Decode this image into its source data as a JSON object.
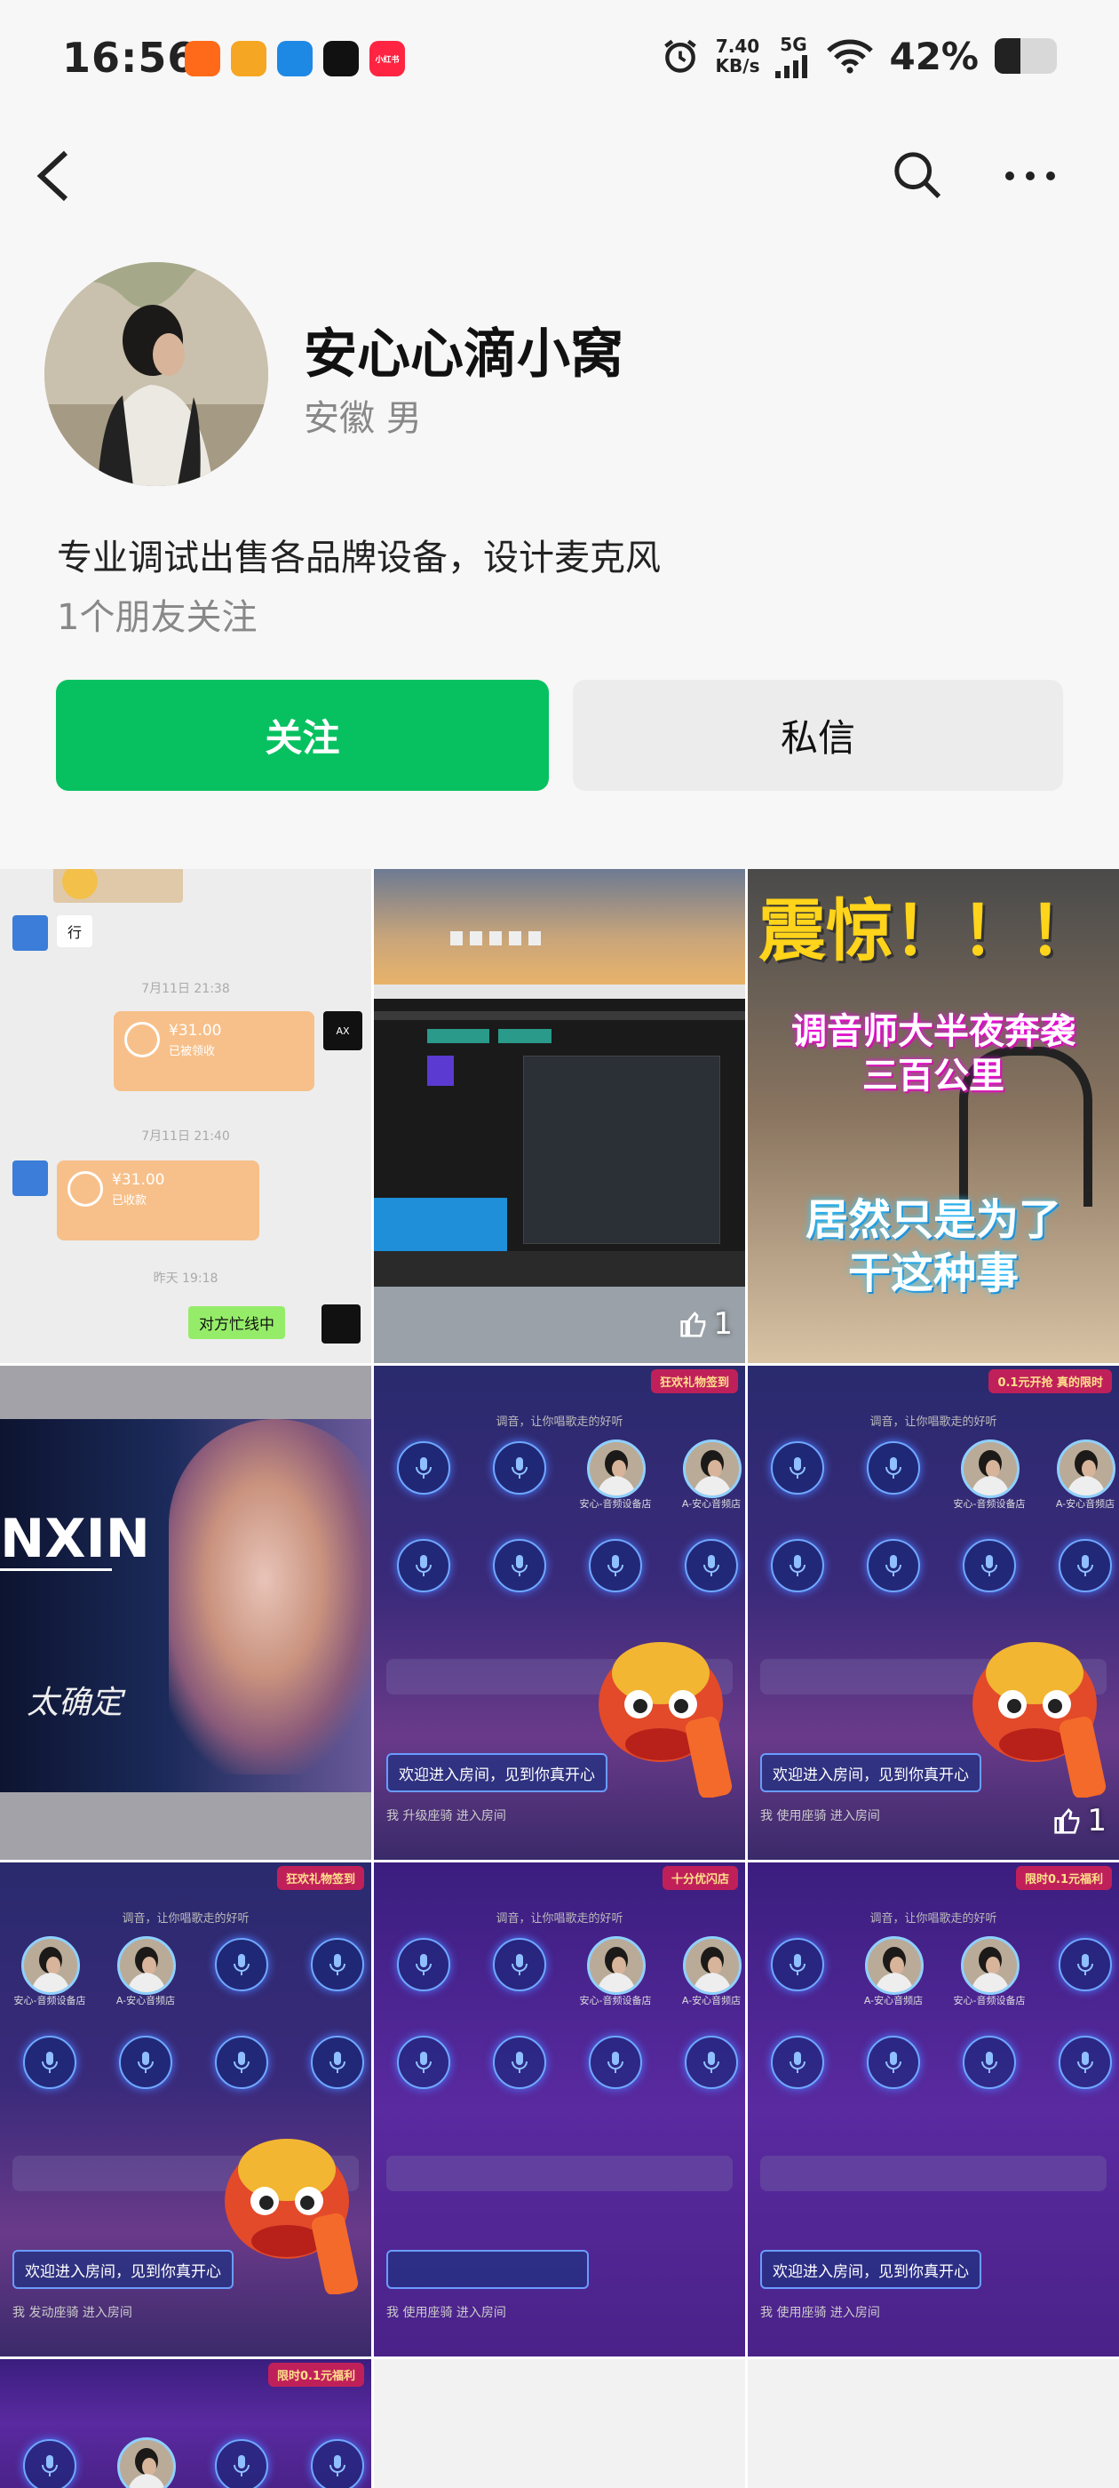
{
  "status_bar": {
    "time": "16:56",
    "net_speed_value": "7.40",
    "net_speed_unit": "KB/s",
    "signal": "5G",
    "battery_percent": "42%",
    "battery_level": 0.42,
    "apps": [
      {
        "name": "kuaishou-icon",
        "color": "#ff6a1a",
        "label": ""
      },
      {
        "name": "tencent-video-icon",
        "color": "#f5a623",
        "label": ""
      },
      {
        "name": "feishu-icon",
        "color": "#1e88e5",
        "label": ""
      },
      {
        "name": "capcut-icon",
        "color": "#111111",
        "label": ""
      },
      {
        "name": "xiaohongshu-icon",
        "color": "#ff2442",
        "label": "小红书"
      }
    ]
  },
  "profile": {
    "name": "安心心滴小窝",
    "meta": "安徽 男",
    "bio": "专业调试出售各品牌设备，设计麦克风",
    "friends": "1个朋友关注"
  },
  "actions": {
    "follow": "关注",
    "message": "私信"
  },
  "posts": {
    "chat": {
      "reply": "行",
      "ts1": "7月11日 21:38",
      "amount1": "¥31.00",
      "status1": "已被领收",
      "ts2": "7月11日 21:40",
      "amount2": "¥31.00",
      "status2": "已收款",
      "ts3": "昨天 19:18",
      "busy": "对方忙线中"
    },
    "daw_likes": "1",
    "shock": {
      "title": "震惊！！！",
      "line1": "调音师大半夜奔袭",
      "line2": "三百公里",
      "line3": "居然只是为了",
      "line4": "干这种事"
    },
    "concert_text": "NXIN",
    "concert_script": "太确定",
    "room": {
      "welcome": "欢迎进入房间，见到你真开心",
      "topic": "调音，让你唱歌走的好听",
      "enter1": "我 升级座骑 进入房间",
      "enter2": "我 使用座骑 进入房间",
      "enter3": "我 发动座骑 进入房间",
      "seat_a": "安心-音频设备店",
      "seat_b": "A-安心音频店",
      "banner1": "狂欢礼物签到",
      "banner2": "0.1元开抢 真的限时",
      "banner3": "十分优闪店",
      "banner4": "限时0.1元福利"
    },
    "room2_likes": "1"
  }
}
